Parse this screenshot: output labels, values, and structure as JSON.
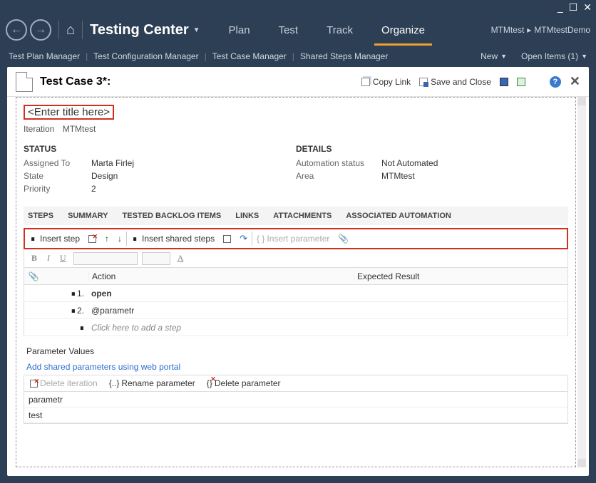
{
  "titlebar": {
    "min": "_",
    "max": "☐",
    "close": "✕"
  },
  "header": {
    "app_title": "Testing Center",
    "tabs": [
      "Plan",
      "Test",
      "Track",
      "Organize"
    ],
    "active_tab": 3,
    "breadcrumb": {
      "a": "MTMtest",
      "sep": "▸",
      "b": "MTMtestDemo"
    }
  },
  "subbar": {
    "links": [
      "Test Plan Manager",
      "Test Configuration Manager",
      "Test Case Manager",
      "Shared Steps Manager"
    ],
    "new_label": "New",
    "open_items_label": "Open Items (1)"
  },
  "doc": {
    "title": "Test Case 3*:",
    "copy_link": "Copy Link",
    "save_close": "Save and Close",
    "entry_placeholder": "<Enter title here>",
    "iteration_label": "Iteration",
    "iteration_value": "MTMtest"
  },
  "status": {
    "head": "STATUS",
    "rows": [
      {
        "label": "Assigned To",
        "value": "Marta Firlej"
      },
      {
        "label": "State",
        "value": "Design"
      },
      {
        "label": "Priority",
        "value": "2"
      }
    ]
  },
  "details": {
    "head": "DETAILS",
    "rows": [
      {
        "label": "Automation status",
        "value": "Not Automated"
      },
      {
        "label": "Area",
        "value": "MTMtest"
      }
    ]
  },
  "section_tabs": [
    "STEPS",
    "SUMMARY",
    "TESTED BACKLOG ITEMS",
    "LINKS",
    "ATTACHMENTS",
    "ASSOCIATED AUTOMATION"
  ],
  "toolbar": {
    "insert_step": "Insert step",
    "insert_shared": "Insert shared steps",
    "insert_param": "Insert parameter"
  },
  "grid": {
    "headers": {
      "action": "Action",
      "expected": "Expected Result"
    },
    "rows": [
      {
        "num": "1.",
        "action": "open",
        "bold": true
      },
      {
        "num": "2.",
        "action": "@parametr",
        "bold": false
      }
    ],
    "placeholder": "Click here to add a step"
  },
  "params": {
    "head": "Parameter Values",
    "link": "Add shared parameters using web portal",
    "delete_iter": "Delete iteration",
    "rename": "Rename parameter",
    "delete_param": "Delete parameter",
    "col": "parametr",
    "val": "test"
  }
}
